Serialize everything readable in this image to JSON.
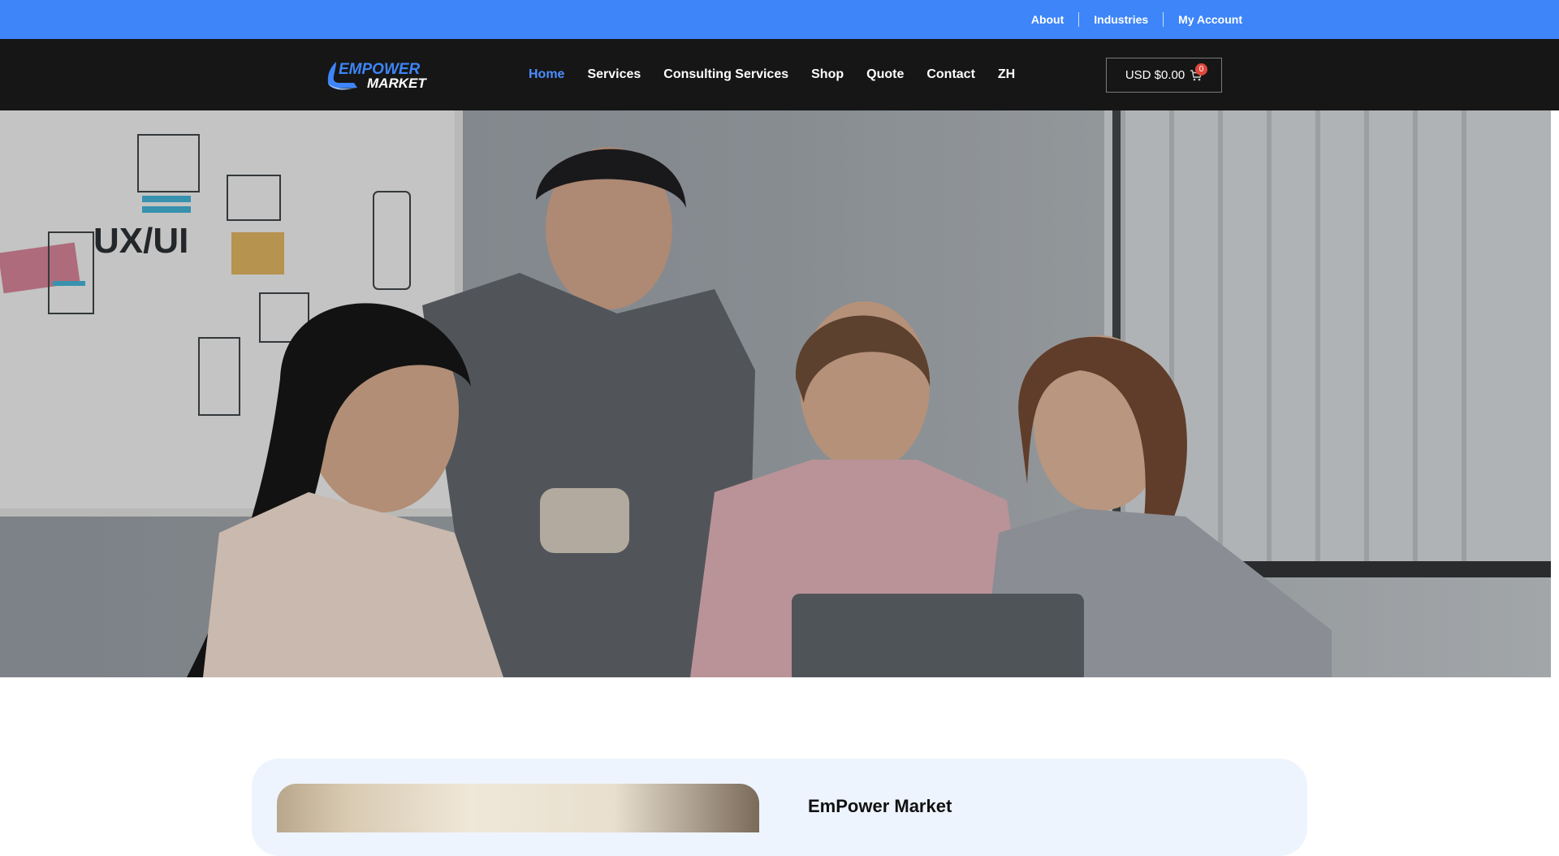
{
  "topbar": {
    "links": [
      "About",
      "Industries",
      "My Account"
    ]
  },
  "header": {
    "logo_line1": "EMPOWER",
    "logo_line2": "MARKET",
    "nav": [
      "Home",
      "Services",
      "Consulting Services",
      "Shop",
      "Quote",
      "Contact",
      "ZH"
    ],
    "active_nav": "Home",
    "cart_label": "USD $0.00",
    "cart_count": "0",
    "icons": [
      "cart-icon"
    ]
  },
  "hero": {
    "image_alt": "Team celebrating in front of a laptop in an office"
  },
  "section": {
    "title": "EmPower Market"
  },
  "colors": {
    "topbar": "#3d85f8",
    "header": "#161616",
    "accent": "#4c8dff",
    "badge": "#e0473b",
    "panel": "#eef4fd"
  }
}
